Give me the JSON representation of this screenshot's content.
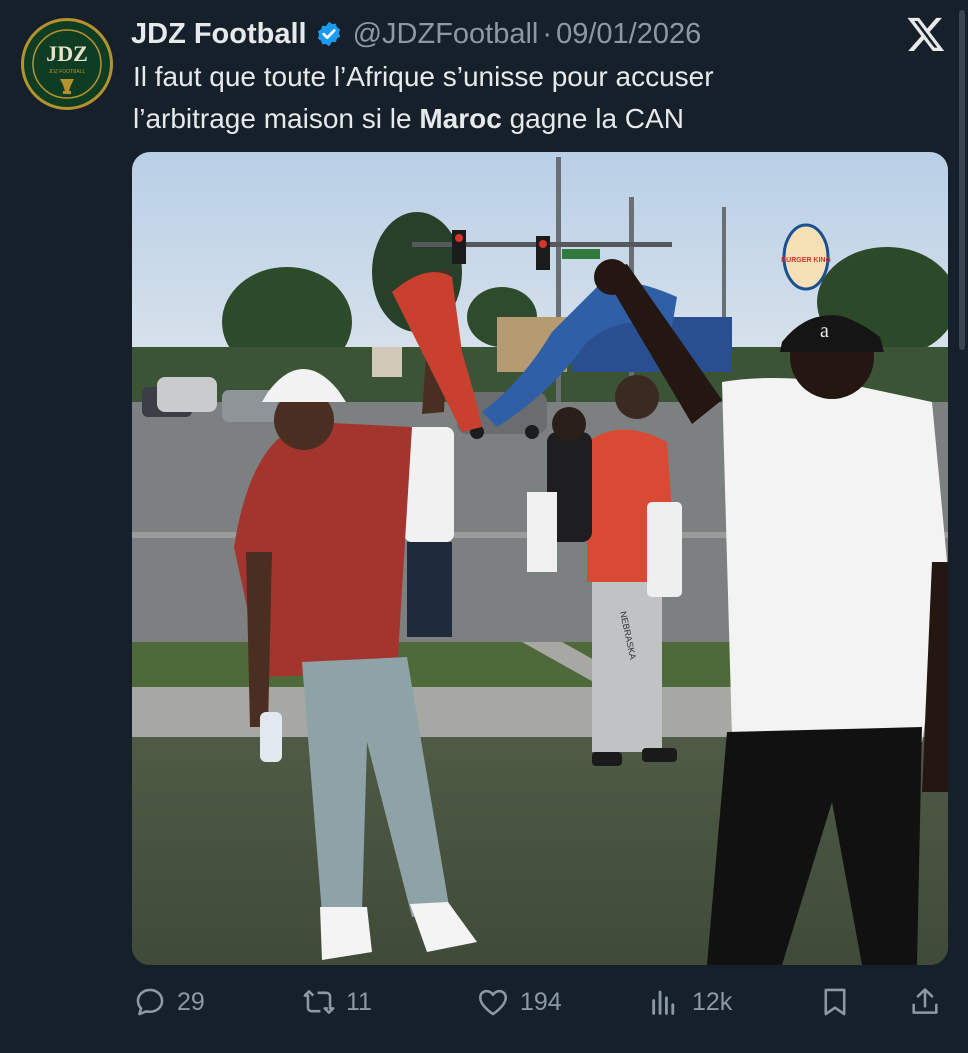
{
  "author": {
    "display_name": "JDZ Football",
    "handle": "@JDZFootball",
    "separator": "·",
    "date": "09/01/2026",
    "avatar_text": "JDZ",
    "avatar_subtext": "JDZ FOOTBALL",
    "verified_color": "#1d9bf0"
  },
  "tweet": {
    "line1": "Il faut que toute l’Afrique s’unisse pour accuser",
    "line2_prefix": "l’arbitrage maison si le ",
    "line2_bold": "Maroc",
    "line2_suffix": " gagne la CAN"
  },
  "media": {
    "burger_sign": "BURGER KING",
    "pants_text": "NEBRASKA",
    "cap_logo": "a"
  },
  "actions": {
    "replies": "29",
    "retweets": "11",
    "likes": "194",
    "views": "12k"
  },
  "colors": {
    "background": "#15202b",
    "text": "#e7e9ea",
    "muted": "#8b98a5",
    "accent": "#1d9bf0"
  },
  "icons": [
    "reply-icon",
    "retweet-icon",
    "like-icon",
    "views-icon",
    "bookmark-icon",
    "share-icon",
    "x-logo-icon",
    "verified-icon"
  ]
}
